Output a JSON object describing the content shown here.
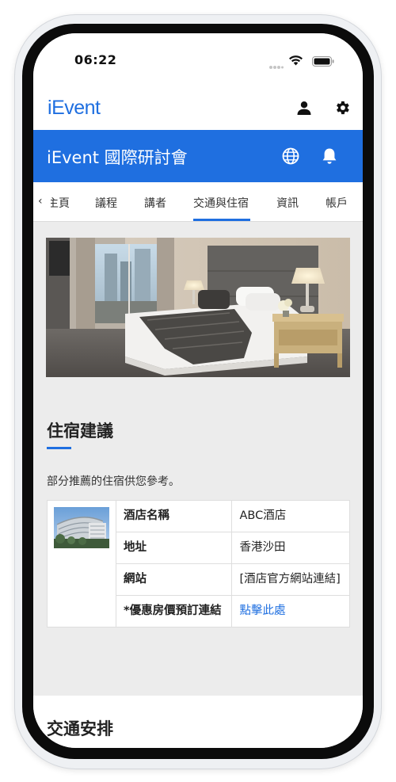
{
  "status_bar": {
    "time": "06:22"
  },
  "header": {
    "logo_i": "i",
    "logo_rest": "Event"
  },
  "title_bar": {
    "title": "iEvent 國際研討會"
  },
  "tabs": [
    {
      "label": "主頁"
    },
    {
      "label": "議程"
    },
    {
      "label": "講者"
    },
    {
      "label": "交通與住宿"
    },
    {
      "label": "資訊"
    },
    {
      "label": "帳戶"
    }
  ],
  "accommodation": {
    "section_title": "住宿建議",
    "intro": "部分推薦的住宿供您參考。",
    "rows": [
      {
        "label": "酒店名稱",
        "value": "ABC酒店"
      },
      {
        "label": "地址",
        "value": "香港沙田"
      },
      {
        "label": "網站",
        "value": "[酒店官方網站連結]"
      },
      {
        "label": "*優惠房價預訂連結",
        "value": "點擊此處"
      }
    ]
  },
  "transport": {
    "section_title": "交通安排"
  },
  "colors": {
    "brand_blue": "#1f6fe0",
    "content_bg": "#ececec"
  }
}
